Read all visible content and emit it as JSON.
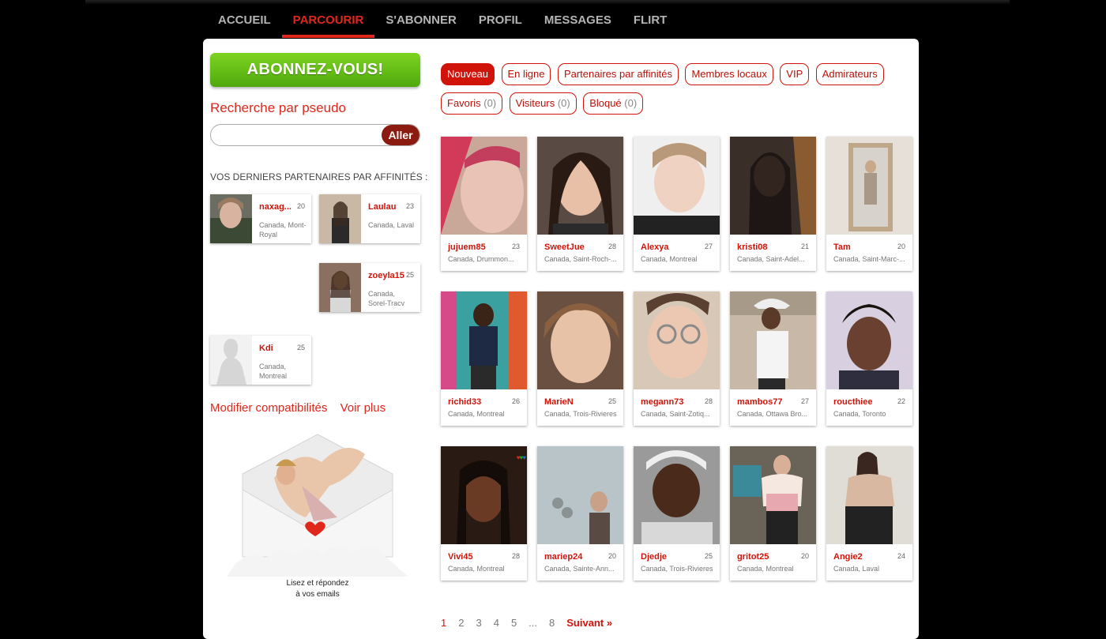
{
  "nav": {
    "items": [
      {
        "label": "ACCUEIL",
        "active": false
      },
      {
        "label": "PARCOURIR",
        "active": true
      },
      {
        "label": "S'ABONNER",
        "active": false
      },
      {
        "label": "PROFIL",
        "active": false
      },
      {
        "label": "MESSAGES",
        "active": false
      },
      {
        "label": "FLIRT",
        "active": false
      }
    ]
  },
  "sidebar": {
    "subscribe_label": "ABONNEZ-VOUS!",
    "search_title": "Recherche par pseudo",
    "search_value": "",
    "search_button": "Aller",
    "affinities_title": "VOS DERNIERS PARTENAIRES PAR AFFINITÉS :",
    "affinities": [
      {
        "name": "naxag...",
        "age": "20",
        "location": "Canada, Mont-Royal"
      },
      {
        "name": "Laulau",
        "age": "23",
        "location": "Canada, Laval"
      },
      {
        "name": "zoeyla15",
        "age": "25",
        "location": "Canada, Sorel-Tracv"
      },
      {
        "name": "Kdi",
        "age": "25",
        "location": "Canada, Montreal"
      }
    ],
    "link_compat": "Modifier compatibilités",
    "link_more": "Voir plus",
    "envelope_caption_1": "Lisez et répondez",
    "envelope_caption_2": "à vos emails"
  },
  "filters": [
    {
      "label": "Nouveau",
      "count": "",
      "active": true
    },
    {
      "label": "En ligne",
      "count": "",
      "active": false
    },
    {
      "label": "Partenaires par affinités",
      "count": "",
      "active": false
    },
    {
      "label": "Membres locaux",
      "count": "",
      "active": false
    },
    {
      "label": "VIP",
      "count": "",
      "active": false
    },
    {
      "label": "Admirateurs",
      "count": "",
      "active": false
    },
    {
      "label": "Favoris",
      "count": "(0)",
      "active": false
    },
    {
      "label": "Visiteurs",
      "count": "(0)",
      "active": false
    },
    {
      "label": "Bloqué",
      "count": "(0)",
      "active": false
    }
  ],
  "profiles": [
    {
      "name": "jujuem85",
      "age": "23",
      "location": "Canada, Drummon..."
    },
    {
      "name": "SweetJue",
      "age": "28",
      "location": "Canada, Saint-Roch-..."
    },
    {
      "name": "Alexya",
      "age": "27",
      "location": "Canada, Montreal"
    },
    {
      "name": "kristi08",
      "age": "21",
      "location": "Canada, Saint-Adel..."
    },
    {
      "name": "Tam",
      "age": "20",
      "location": "Canada, Saint-Marc-..."
    },
    {
      "name": "richid33",
      "age": "26",
      "location": "Canada, Montreal"
    },
    {
      "name": "MarieN",
      "age": "25",
      "location": "Canada, Trois-Rivieres"
    },
    {
      "name": "megann73",
      "age": "28",
      "location": "Canada, Saint-Zotiq..."
    },
    {
      "name": "mambos77",
      "age": "27",
      "location": "Canada, Ottawa Bro..."
    },
    {
      "name": "roucthiee",
      "age": "22",
      "location": "Canada, Toronto"
    },
    {
      "name": "Vivi45",
      "age": "28",
      "location": "Canada, Montreal"
    },
    {
      "name": "mariep24",
      "age": "20",
      "location": "Canada, Sainte-Ann..."
    },
    {
      "name": "Djedje",
      "age": "25",
      "location": "Canada, Trois-Rivieres"
    },
    {
      "name": "gritot25",
      "age": "20",
      "location": "Canada, Montreal"
    },
    {
      "name": "Angie2",
      "age": "24",
      "location": "Canada, Laval"
    }
  ],
  "pagination": {
    "pages": [
      "1",
      "2",
      "3",
      "4",
      "5",
      "...",
      "8"
    ],
    "current": "1",
    "next_label": "Suivant »"
  },
  "colors": {
    "accent": "#e0271b",
    "subscribe": "#5cb616",
    "search_button": "#8b1a10"
  }
}
